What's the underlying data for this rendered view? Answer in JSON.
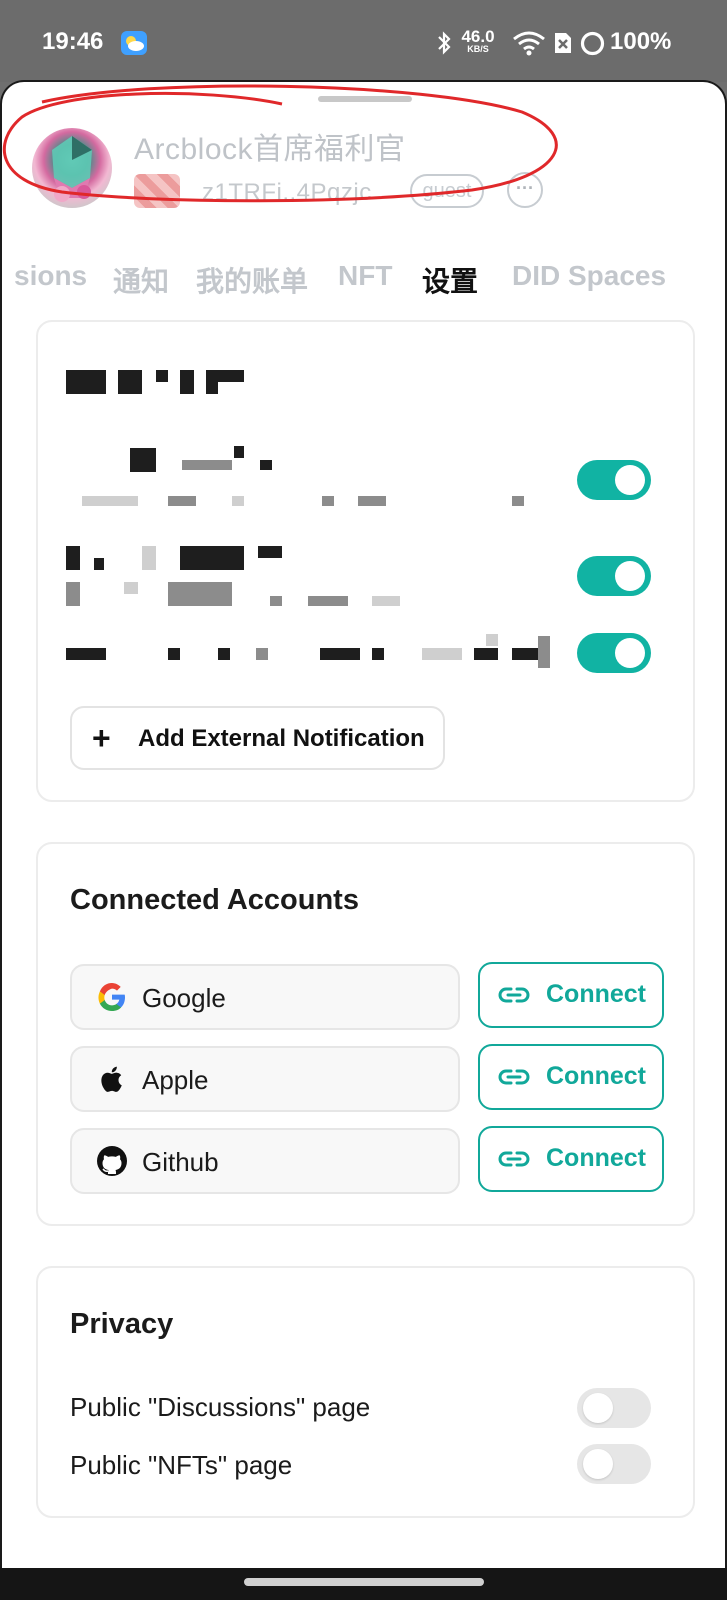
{
  "status_bar": {
    "time": "19:46",
    "net_speed_value": "46.0",
    "net_speed_unit": "KB/S",
    "battery": "100%",
    "icons": [
      "weather-icon",
      "bluetooth-icon",
      "wifi-icon",
      "sim-icon",
      "battery-icon"
    ]
  },
  "profile": {
    "name": "Arcblock首席福利官",
    "did": "z1TRFi..4Pqzjc",
    "role": "guest",
    "more": "···"
  },
  "tabs": [
    "sions",
    "通知",
    "我的账单",
    "NFT",
    "设置",
    "DID Spaces"
  ],
  "active_tab": "设置",
  "notifications": {
    "toggles": [
      true,
      true,
      true
    ],
    "add_button": "Add External Notification"
  },
  "connected_accounts": {
    "title": "Connected Accounts",
    "providers": [
      {
        "name": "Google",
        "icon": "google-icon",
        "action": "Connect"
      },
      {
        "name": "Apple",
        "icon": "apple-icon",
        "action": "Connect"
      },
      {
        "name": "Github",
        "icon": "github-icon",
        "action": "Connect"
      }
    ]
  },
  "privacy": {
    "title": "Privacy",
    "items": [
      {
        "label": "Public \"Discussions\" page",
        "enabled": false
      },
      {
        "label": "Public \"NFTs\" page",
        "enabled": false
      }
    ]
  },
  "colors": {
    "accent": "#11b3a3",
    "annotation": "#e0282a"
  }
}
